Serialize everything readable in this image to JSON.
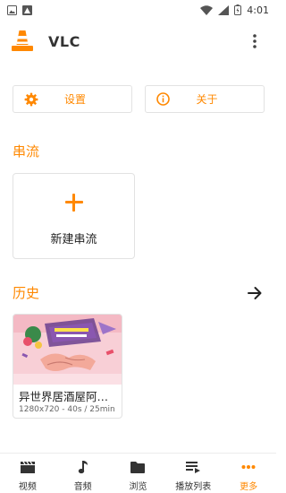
{
  "status_bar": {
    "time": "4:01"
  },
  "app_bar": {
    "title": "VLC"
  },
  "actions": {
    "settings_label": "设置",
    "about_label": "关于"
  },
  "streams": {
    "title": "串流",
    "new_stream_label": "新建串流"
  },
  "history": {
    "title": "历史",
    "items": [
      {
        "title": "异世界居酒屋阿…",
        "meta": "1280x720 - 40s / 25min"
      }
    ]
  },
  "bottom_nav": {
    "items": [
      {
        "label": "视频",
        "icon": "clapperboard-icon"
      },
      {
        "label": "音频",
        "icon": "music-note-icon"
      },
      {
        "label": "浏览",
        "icon": "folder-icon"
      },
      {
        "label": "播放列表",
        "icon": "playlist-icon"
      },
      {
        "label": "更多",
        "icon": "more-dots-icon",
        "active": true
      }
    ]
  },
  "colors": {
    "accent": "#ff8800",
    "border": "#e2e2e2",
    "text": "#222222"
  }
}
